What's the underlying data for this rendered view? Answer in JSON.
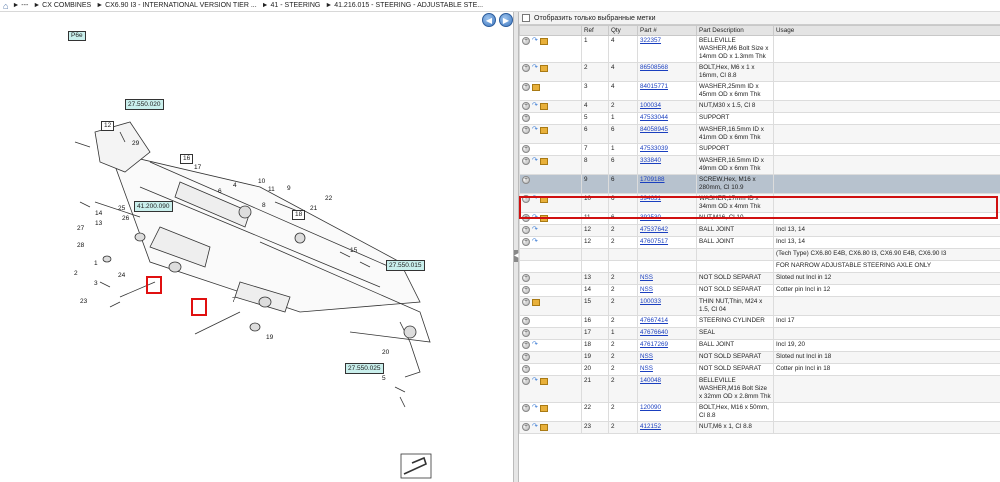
{
  "breadcrumb": {
    "items": [
      "► ---",
      "► CX COMBINES",
      "► CX6.90 I3 - INTERNATIONAL VERSION TIER ...",
      "► 41 - STEERING",
      "► 41.216.015 - STEERING - ADJUSTABLE STE..."
    ]
  },
  "filter": {
    "label": "Отобразить только выбранные метки"
  },
  "diagram": {
    "page_label": "P6e",
    "refs": [
      "27.550.020",
      "41.200.090",
      "27.550.015",
      "27.550.025"
    ],
    "callouts": [
      "12",
      "16",
      "18",
      "17",
      "6",
      "4",
      "10",
      "11",
      "8",
      "9",
      "22",
      "21",
      "15",
      "25",
      "14",
      "13",
      "26",
      "27",
      "28",
      "29",
      "7",
      "1",
      "2",
      "3",
      "5",
      "19",
      "20",
      "23",
      "24"
    ]
  },
  "table": {
    "headers": [
      "Ref",
      "Qty",
      "Part #",
      "Part Description",
      "Usage"
    ],
    "rows": [
      {
        "icons": "gwb",
        "ref": "1",
        "qty": "4",
        "part": "322357",
        "desc": "BELLEVILLE WASHER,M6 Bolt Size x 14mm OD x 1.3mm Thk",
        "usage": ""
      },
      {
        "icons": "gwb",
        "ref": "2",
        "qty": "4",
        "part": "86508568",
        "desc": "BOLT,Hex, M6 x 1 x 16mm, Cl 8.8",
        "usage": ""
      },
      {
        "icons": "gb",
        "ref": "3",
        "qty": "4",
        "part": "84015771",
        "desc": "WASHER,25mm ID x 45mm OD x 6mm Thk",
        "usage": ""
      },
      {
        "icons": "gwb",
        "ref": "4",
        "qty": "2",
        "part": "100034",
        "desc": "NUT,M30 x 1.5, Cl 8",
        "usage": ""
      },
      {
        "icons": "g",
        "ref": "5",
        "qty": "1",
        "part": "47533044",
        "desc": "SUPPORT",
        "usage": ""
      },
      {
        "icons": "gwb",
        "ref": "6",
        "qty": "6",
        "part": "84058945",
        "desc": "WASHER,16.5mm ID x 41mm OD x 6mm Thk",
        "usage": ""
      },
      {
        "icons": "g",
        "ref": "7",
        "qty": "1",
        "part": "47533039",
        "desc": "SUPPORT",
        "usage": ""
      },
      {
        "icons": "gwb",
        "ref": "8",
        "qty": "6",
        "part": "333840",
        "desc": "WASHER,16.5mm ID x 49mm OD x 6mm Thk",
        "usage": ""
      },
      {
        "icons": "g",
        "ref": "9",
        "qty": "6",
        "part": "1709188",
        "desc": "SCREW,Hex, M16 x 280mm, Cl 10.9",
        "usage": "",
        "selected": true
      },
      {
        "icons": "gwb",
        "ref": "10",
        "qty": "6",
        "part": "394631",
        "desc": "WASHER,17mm ID x 34mm OD x 4mm Thk",
        "usage": ""
      },
      {
        "icons": "gwb",
        "ref": "11",
        "qty": "6",
        "part": "392530",
        "desc": "NUT,M16, Cl 10",
        "usage": ""
      },
      {
        "icons": "gw",
        "ref": "12",
        "qty": "2",
        "part": "47537642",
        "desc": "BALL JOINT",
        "usage": "Incl 13, 14"
      },
      {
        "icons": "gw",
        "ref": "12",
        "qty": "2",
        "part": "47607517",
        "desc": "BALL JOINT",
        "usage": "Incl 13, 14"
      },
      {
        "icons": "",
        "ref": "",
        "qty": "",
        "part": "",
        "desc": "",
        "usage": "(Tech Type) CX6.80 E4B, CX6.80 I3, CX6.90 E4B, CX6.90 I3"
      },
      {
        "icons": "",
        "ref": "",
        "qty": "",
        "part": "",
        "desc": "",
        "usage": "FOR NARROW ADJUSTABLE STEERING AXLE ONLY"
      },
      {
        "icons": "g",
        "ref": "13",
        "qty": "2",
        "part": "NSS",
        "desc": "NOT SOLD SEPARAT",
        "usage": "Sloted nut Incl in 12"
      },
      {
        "icons": "g",
        "ref": "14",
        "qty": "2",
        "part": "NSS",
        "desc": "NOT SOLD SEPARAT",
        "usage": "Cotter pin Incl in 12"
      },
      {
        "icons": "gb",
        "ref": "15",
        "qty": "2",
        "part": "100033",
        "desc": "THIN NUT,Thin, M24 x 1.5, Cl 04",
        "usage": ""
      },
      {
        "icons": "g",
        "ref": "16",
        "qty": "2",
        "part": "47667414",
        "desc": "STEERING CYLINDER",
        "usage": "Incl 17"
      },
      {
        "icons": "g",
        "ref": "17",
        "qty": "1",
        "part": "47676640",
        "desc": "SEAL",
        "usage": ""
      },
      {
        "icons": "gw",
        "ref": "18",
        "qty": "2",
        "part": "47617269",
        "desc": "BALL JOINT",
        "usage": "Incl 19, 20"
      },
      {
        "icons": "g",
        "ref": "19",
        "qty": "2",
        "part": "NSS",
        "desc": "NOT SOLD SEPARAT",
        "usage": "Sloted nut Incl in 18"
      },
      {
        "icons": "g",
        "ref": "20",
        "qty": "2",
        "part": "NSS",
        "desc": "NOT SOLD SEPARAT",
        "usage": "Cotter pin Incl in 18"
      },
      {
        "icons": "gwb",
        "ref": "21",
        "qty": "2",
        "part": "140048",
        "desc": "BELLEVILLE WASHER,M16 Bolt Size x 32mm OD x 2.8mm Thk",
        "usage": ""
      },
      {
        "icons": "gwb",
        "ref": "22",
        "qty": "2",
        "part": "120090",
        "desc": "BOLT,Hex, M16 x 50mm, Cl 8.8",
        "usage": ""
      },
      {
        "icons": "gwb",
        "ref": "23",
        "qty": "2",
        "part": "412152",
        "desc": "NUT,M6 x 1, Cl 8.8",
        "usage": ""
      }
    ]
  }
}
